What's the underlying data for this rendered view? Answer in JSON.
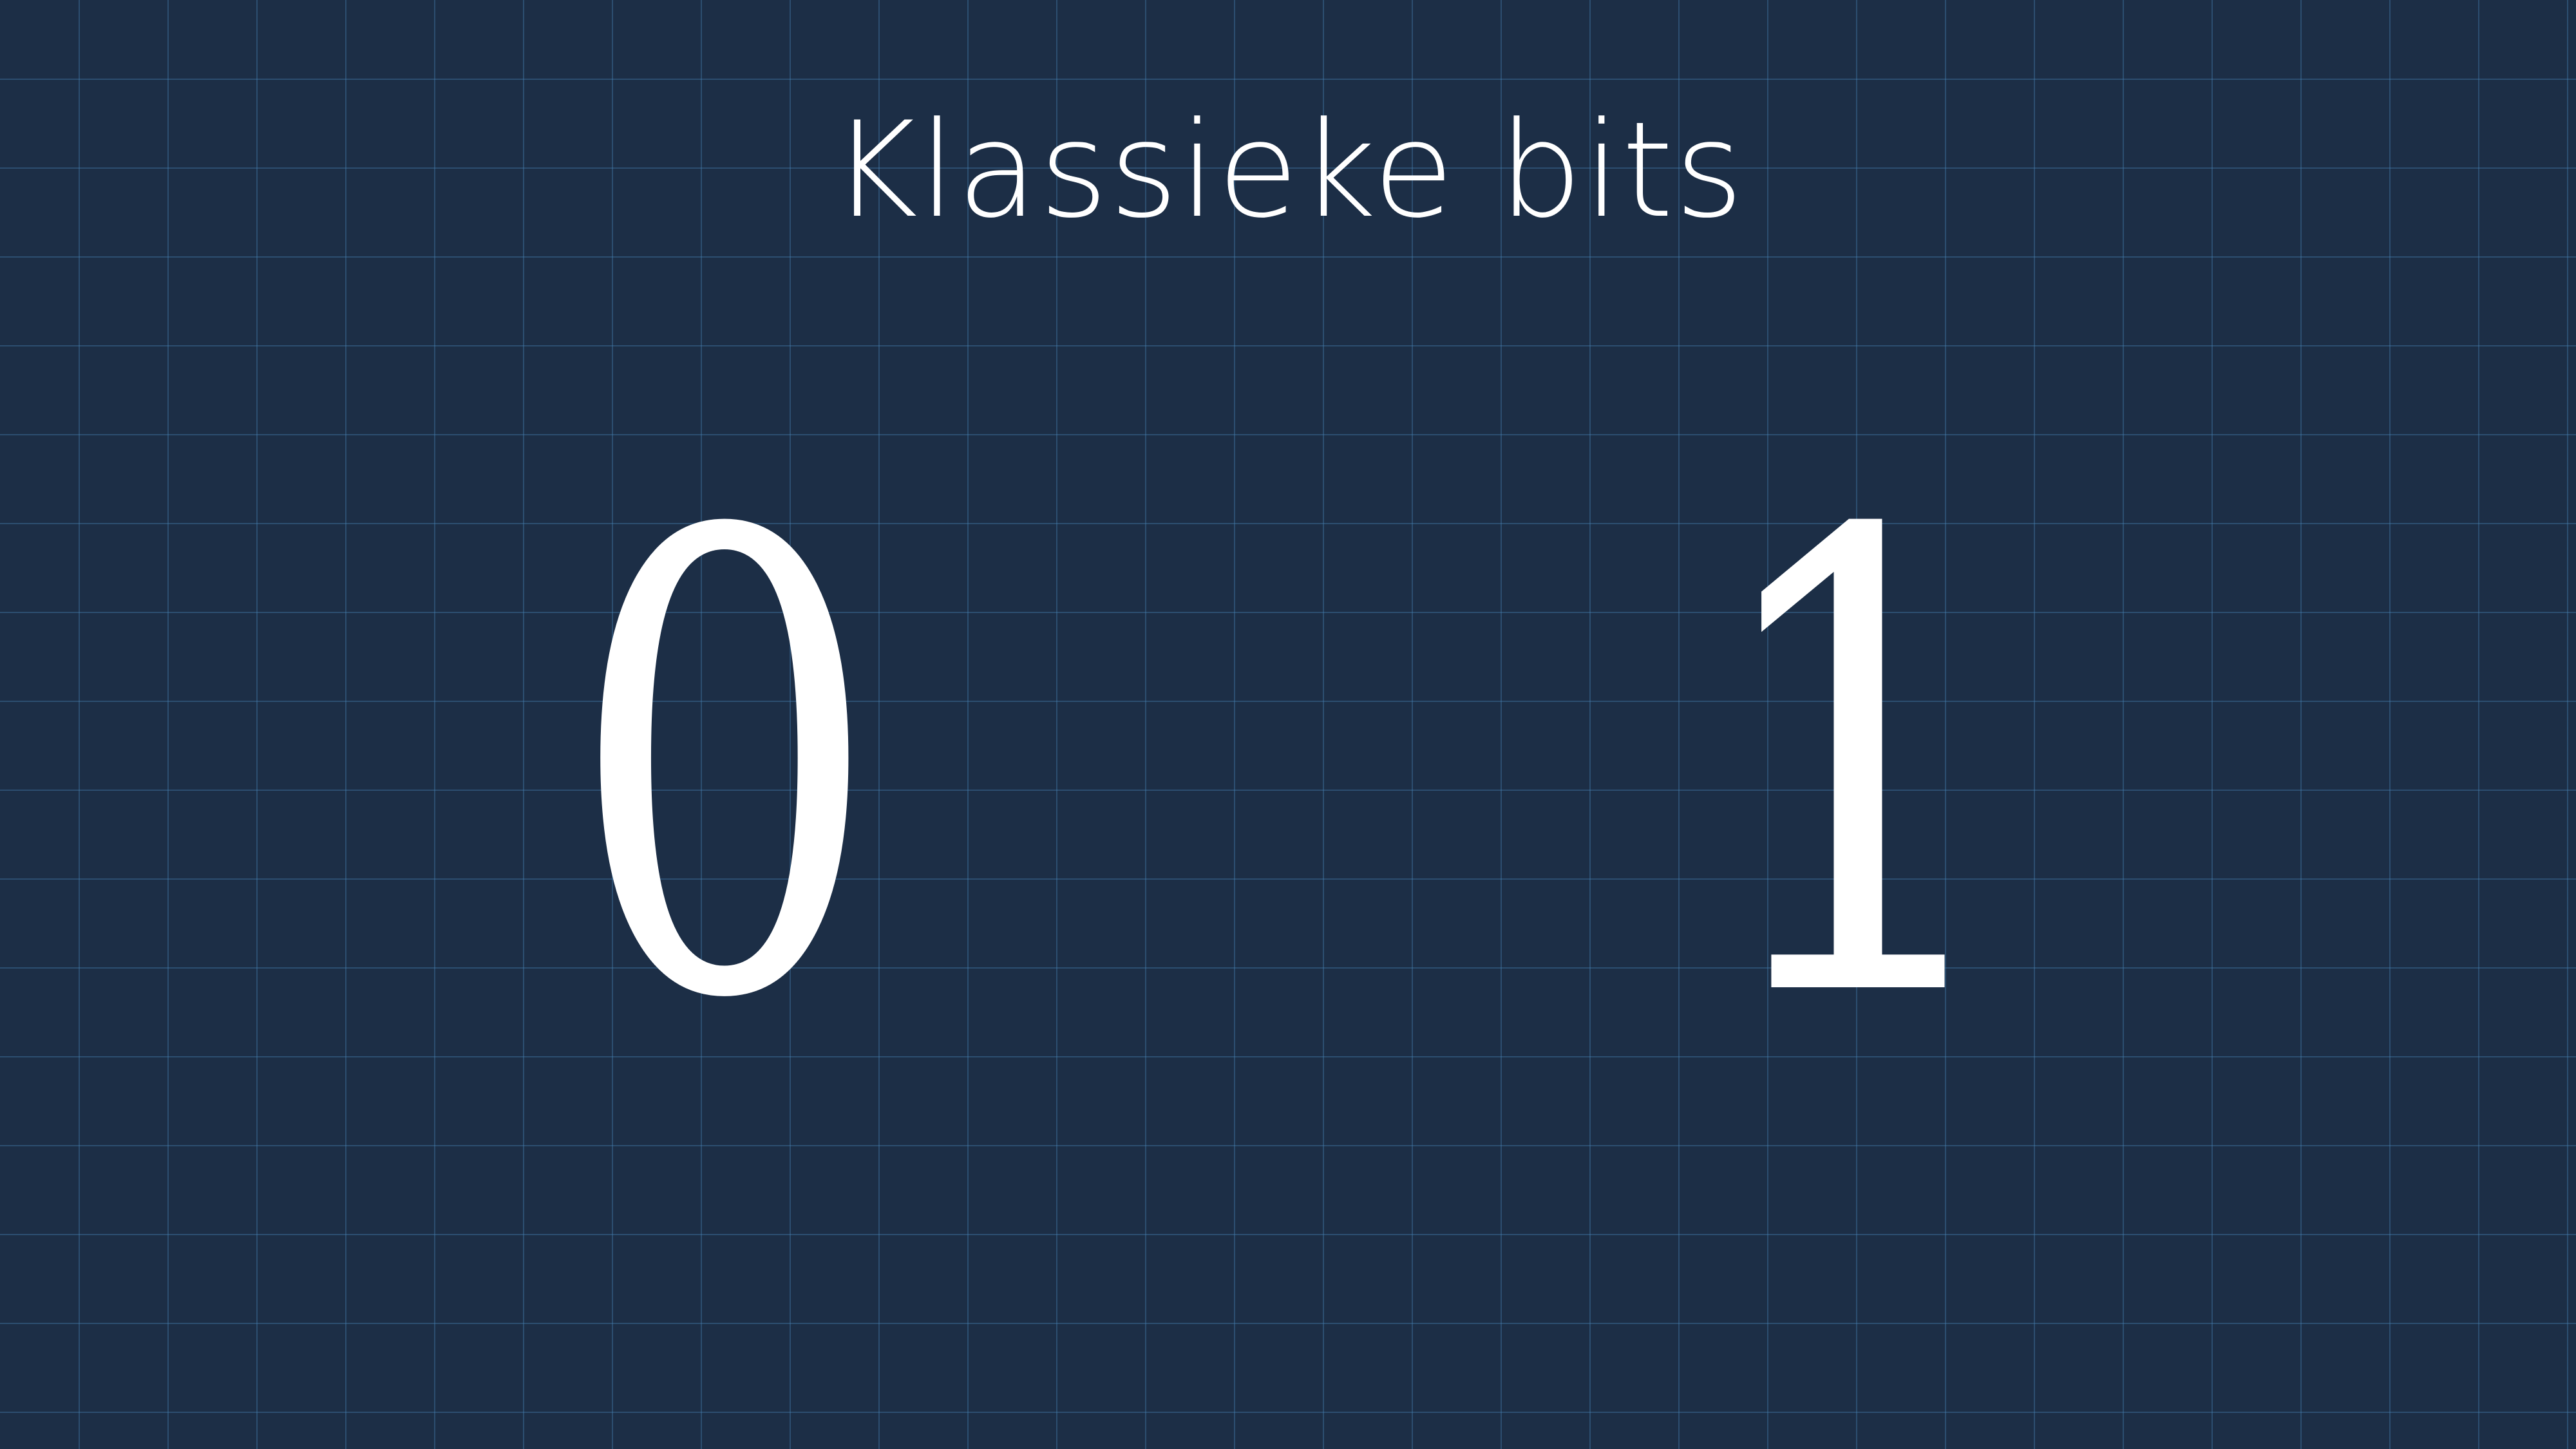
{
  "slide": {
    "title": "Klassieke bits",
    "bits": [
      "0",
      "1"
    ],
    "colors": {
      "background": "#1c2e46",
      "grid": "#3f6f9a",
      "text": "#ffffff"
    }
  }
}
